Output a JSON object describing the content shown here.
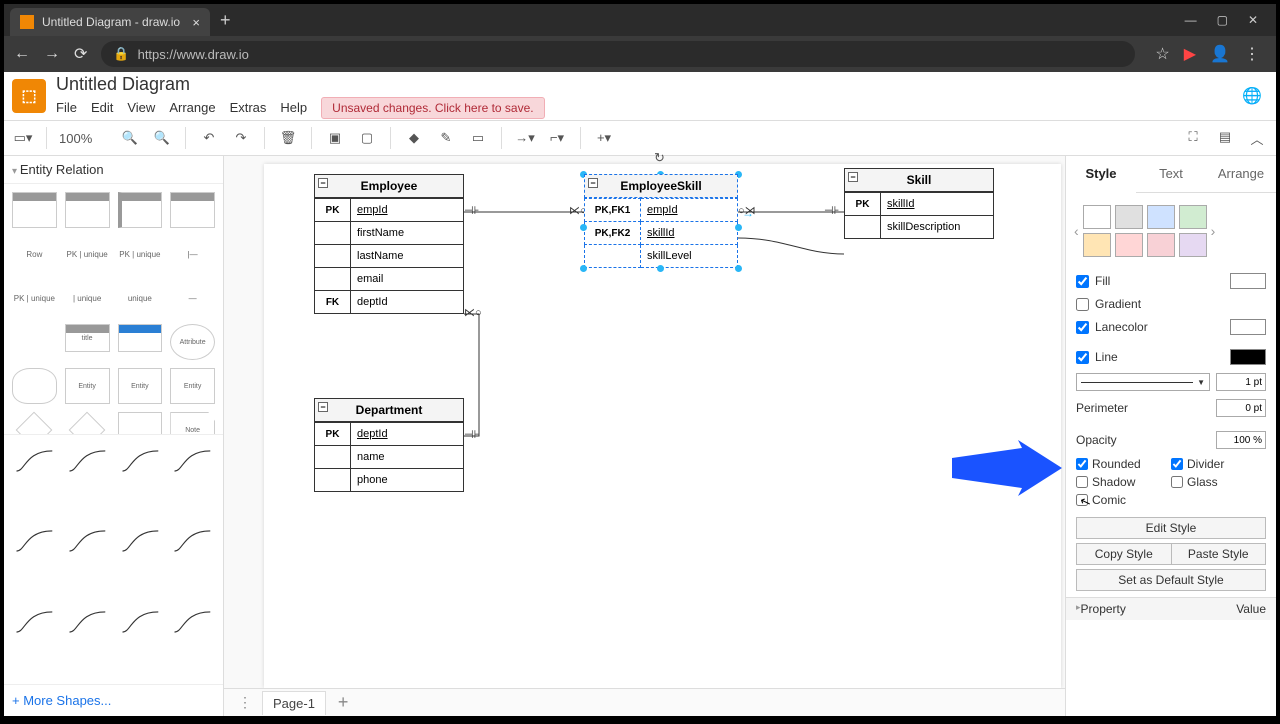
{
  "browser": {
    "tab_title": "Untitled Diagram - draw.io",
    "url": "https://www.draw.io"
  },
  "app": {
    "title": "Untitled Diagram",
    "menus": [
      "File",
      "Edit",
      "View",
      "Arrange",
      "Extras",
      "Help"
    ],
    "unsaved_warning": "Unsaved changes. Click here to save."
  },
  "toolbar": {
    "zoom": "100%"
  },
  "palette": {
    "section": "Entity Relation",
    "row_label": "Row",
    "more": "+ More Shapes..."
  },
  "canvas": {
    "entities": {
      "employee": {
        "title": "Employee",
        "rows": [
          {
            "key": "PK",
            "name": "empId",
            "u": true
          },
          {
            "key": "",
            "name": "firstName"
          },
          {
            "key": "",
            "name": "lastName"
          },
          {
            "key": "",
            "name": "email"
          },
          {
            "key": "FK",
            "name": "deptId"
          }
        ]
      },
      "employeeSkill": {
        "title": "EmployeeSkill",
        "rows": [
          {
            "key": "PK,FK1",
            "name": "empId",
            "u": true
          },
          {
            "key": "PK,FK2",
            "name": "skillId",
            "u": true
          },
          {
            "key": "",
            "name": "skillLevel"
          }
        ]
      },
      "skill": {
        "title": "Skill",
        "rows": [
          {
            "key": "PK",
            "name": "skillId",
            "u": true
          },
          {
            "key": "",
            "name": "skillDescription"
          }
        ]
      },
      "department": {
        "title": "Department",
        "rows": [
          {
            "key": "PK",
            "name": "deptId",
            "u": true
          },
          {
            "key": "",
            "name": "name"
          },
          {
            "key": "",
            "name": "phone"
          }
        ]
      }
    }
  },
  "pages": {
    "page1": "Page-1"
  },
  "right": {
    "tabs": [
      "Style",
      "Text",
      "Arrange"
    ],
    "swatch_colors": [
      "#ffffff",
      "#e0e0e0",
      "#cfe2ff",
      "#d1ecd1",
      "#ffe5b4",
      "#ffd6d6",
      "#f8d1d6",
      "#e6d9f2"
    ],
    "fill_label": "Fill",
    "fill_color": "#ffffff",
    "gradient_label": "Gradient",
    "lanecolor_label": "Lanecolor",
    "lanecolor": "#ffffff",
    "line_label": "Line",
    "line_color": "#000000",
    "line_width": "1 pt",
    "perimeter_label": "Perimeter",
    "perimeter_value": "0 pt",
    "opacity_label": "Opacity",
    "opacity_value": "100 %",
    "rounded": "Rounded",
    "divider": "Divider",
    "shadow": "Shadow",
    "glass": "Glass",
    "comic": "Comic",
    "edit_style": "Edit Style",
    "copy_style": "Copy Style",
    "paste_style": "Paste Style",
    "default_style": "Set as Default Style",
    "property": "Property",
    "value": "Value"
  }
}
